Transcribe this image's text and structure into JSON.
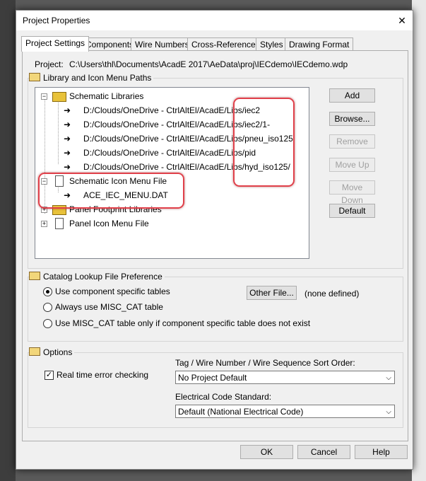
{
  "window": {
    "title": "Project Properties",
    "close_glyph": "✕"
  },
  "tabs": [
    {
      "label": "Project Settings",
      "active": true
    },
    {
      "label": "Components"
    },
    {
      "label": "Wire Numbers"
    },
    {
      "label": "Cross-References"
    },
    {
      "label": "Styles"
    },
    {
      "label": "Drawing Format"
    }
  ],
  "project": {
    "label": "Project:",
    "path": "C:\\Users\\thl\\Documents\\AcadE 2017\\AeData\\proj\\IECdemo\\IECdemo.wdp"
  },
  "library_group": {
    "title": "Library and Icon Menu Paths",
    "tree": {
      "schematic_libraries": {
        "label": "Schematic Libraries",
        "paths": [
          "D:/Clouds/OneDrive - CtrlAltEl/AcadE/Libs/iec2",
          "D:/Clouds/OneDrive - CtrlAltEl/AcadE/Libs/iec2/1-",
          "D:/Clouds/OneDrive - CtrlAltEl/AcadE/Libs/pneu_iso125",
          "D:/Clouds/OneDrive - CtrlAltEl/AcadE/Libs/pid",
          "D:/Clouds/OneDrive - CtrlAltEl/AcadE/Libs/hyd_iso125/"
        ]
      },
      "schematic_icon_menu_file": {
        "label": "Schematic Icon Menu File",
        "file": "ACE_IEC_MENU.DAT"
      },
      "panel_footprint_libraries": {
        "label": "Panel Footprint Libraries"
      },
      "panel_icon_menu_file": {
        "label": "Panel Icon Menu File"
      }
    },
    "buttons": {
      "add": "Add",
      "browse": "Browse...",
      "remove": "Remove",
      "move_up": "Move Up",
      "move_down": "Move Down",
      "default": "Default"
    }
  },
  "catalog_group": {
    "title": "Catalog Lookup File Preference",
    "options": [
      "Use component specific tables",
      "Always use MISC_CAT table",
      "Use MISC_CAT table only if component specific table does not exist"
    ],
    "selected_index": 0,
    "other_file_button": "Other File...",
    "other_file_value": "(none defined)"
  },
  "options_group": {
    "title": "Options",
    "realtime_check": {
      "label": "Real time error checking",
      "checked": true,
      "glyph": "✓"
    },
    "sort_order": {
      "label": "Tag / Wire Number / Wire Sequence Sort Order:",
      "value": "No Project Default"
    },
    "electrical_code": {
      "label": "Electrical Code Standard:",
      "value": "Default (National Electrical Code)"
    }
  },
  "footer": {
    "ok": "OK",
    "cancel": "Cancel",
    "help": "Help"
  },
  "icons": {
    "expander_minus": "−",
    "expander_plus": "+",
    "path_arrow": "➜",
    "dropdown": "⌵"
  },
  "colors": {
    "highlight": "#e0404a",
    "folder": "#e8c23a"
  }
}
